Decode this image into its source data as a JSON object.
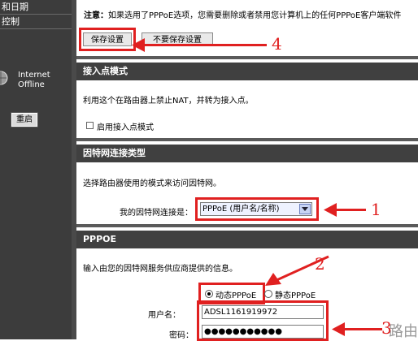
{
  "sidebar": {
    "items": [
      {
        "label": "和日期"
      },
      {
        "label": "控制"
      }
    ],
    "status_line1": "Internet",
    "status_line2": "Offline",
    "reboot_label": "重启"
  },
  "notice": {
    "label": "注意：",
    "text": "如果选用了PPPoE选项，您需要删除或者禁用您计算机上的任何PPPoE客户端软件"
  },
  "actions": {
    "save_label": "保存设置",
    "dont_save_label": "不要保存设置"
  },
  "ap_mode": {
    "title": "接入点模式",
    "description": "利用这个在路由器上禁止NAT，并转为接入点。",
    "checkbox_label": "启用接入点模式"
  },
  "conn_type": {
    "title": "因特网连接类型",
    "description": "选择路由器使用的模式来访问因特网。",
    "select_label": "我的因特网连接是：",
    "select_value": "PPPoE (用户名/名称)"
  },
  "pppoe": {
    "title": "PPPOE",
    "description": "输入由您的因特网服务供应商提供的信息。",
    "dynamic_label": "动态PPPoE",
    "static_label": "静态PPPoE",
    "username_label": "用户名：",
    "username_value": "ADSL1161919972",
    "password_label": "密码：",
    "password_value": "●●●●●●●●●●●"
  },
  "annotations": {
    "n1": "1",
    "n2": "2",
    "n3": "3",
    "n4": "4"
  },
  "watermark": "路由网",
  "colors": {
    "sidebar": "#3c3c3c",
    "header": "#404040",
    "highlight": "#e02020"
  }
}
